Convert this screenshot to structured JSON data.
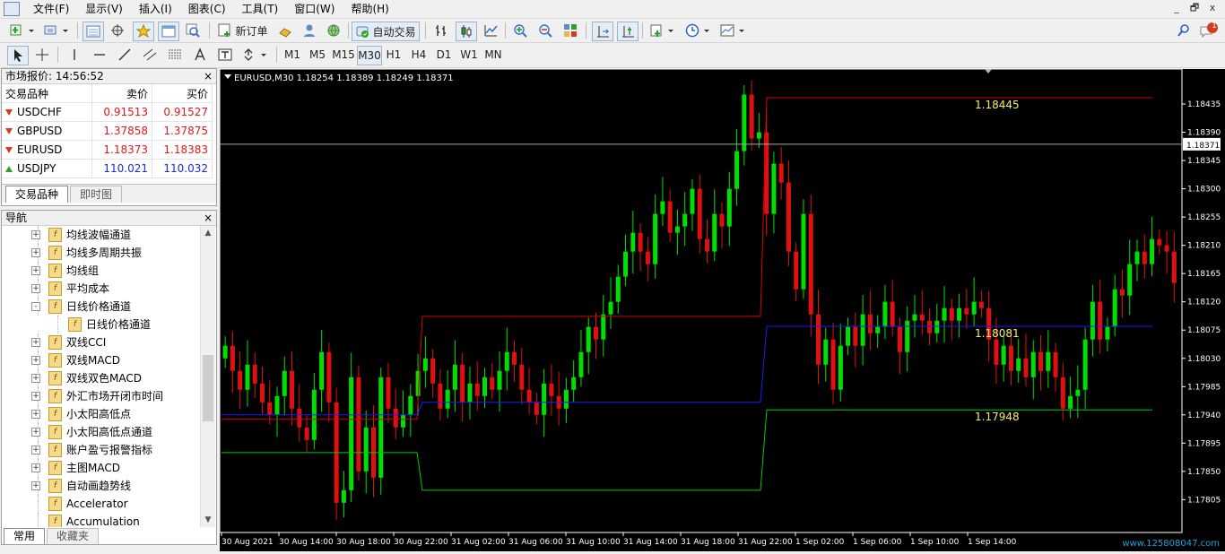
{
  "menu": [
    "文件(F)",
    "显示(V)",
    "插入(I)",
    "图表(C)",
    "工具(T)",
    "窗口(W)",
    "帮助(H)"
  ],
  "window_controls": [
    "_",
    "🗗",
    "x"
  ],
  "toolbar1": {
    "new_order": "新订单",
    "auto_trade": "自动交易",
    "notification_count": "1"
  },
  "timeframes": [
    "M1",
    "M5",
    "M15",
    "M30",
    "H1",
    "H4",
    "D1",
    "W1",
    "MN"
  ],
  "active_timeframe": "M30",
  "market_watch": {
    "title": "市场报价: 14:56:52",
    "headers": [
      "交易品种",
      "卖价",
      "买价"
    ],
    "rows": [
      {
        "symbol": "USDCHF",
        "bid": "0.91513",
        "ask": "0.91527",
        "dir": "down",
        "color": "red"
      },
      {
        "symbol": "GBPUSD",
        "bid": "1.37858",
        "ask": "1.37875",
        "dir": "down",
        "color": "red"
      },
      {
        "symbol": "EURUSD",
        "bid": "1.18373",
        "ask": "1.18383",
        "dir": "down",
        "color": "red"
      },
      {
        "symbol": "USDJPY",
        "bid": "110.021",
        "ask": "110.032",
        "dir": "up",
        "color": "blue"
      }
    ],
    "tabs": [
      "交易品种",
      "即时图"
    ]
  },
  "navigator": {
    "title": "导航",
    "items": [
      {
        "label": "均线波幅通道",
        "level": 0,
        "exp": "+"
      },
      {
        "label": "均线多周期共振",
        "level": 0,
        "exp": "+"
      },
      {
        "label": "均线组",
        "level": 0,
        "exp": "+"
      },
      {
        "label": "平均成本",
        "level": 0,
        "exp": "+"
      },
      {
        "label": "日线价格通道",
        "level": 0,
        "exp": "-"
      },
      {
        "label": "日线价格通道",
        "level": 1,
        "exp": ""
      },
      {
        "label": "双线CCI",
        "level": 0,
        "exp": "+"
      },
      {
        "label": "双线MACD",
        "level": 0,
        "exp": "+"
      },
      {
        "label": "双线双色MACD",
        "level": 0,
        "exp": "+"
      },
      {
        "label": "外汇市场开闭市时间",
        "level": 0,
        "exp": "+"
      },
      {
        "label": "小太阳高低点",
        "level": 0,
        "exp": "+"
      },
      {
        "label": "小太阳高低点通道",
        "level": 0,
        "exp": "+"
      },
      {
        "label": "账户盈亏报警指标",
        "level": 0,
        "exp": "+"
      },
      {
        "label": "主图MACD",
        "level": 0,
        "exp": "+"
      },
      {
        "label": "自动画趋势线",
        "level": 0,
        "exp": "+"
      },
      {
        "label": "Accelerator",
        "level": 0,
        "exp": ""
      },
      {
        "label": "Accumulation",
        "level": 0,
        "exp": ""
      }
    ],
    "footer_tabs": [
      "常用",
      "收藏夹"
    ]
  },
  "chart": {
    "header": "EURUSD,M30  1.18254 1.18389 1.18249 1.18371",
    "current_price_label": "1.18371",
    "level_labels": {
      "upper": "1.18445",
      "middle": "1.18081",
      "lower": "1.17948"
    },
    "watermark": "www.125808047.com"
  },
  "chart_data": {
    "type": "candlestick",
    "symbol": "EURUSD",
    "timeframe": "M30",
    "ylim": [
      1.17757,
      1.18485
    ],
    "y_ticks": [
      "1.18435",
      "1.18390",
      "1.18345",
      "1.18300",
      "1.18255",
      "1.18210",
      "1.18165",
      "1.18120",
      "1.18075",
      "1.18030",
      "1.17985",
      "1.17940",
      "1.17895",
      "1.17850",
      "1.17805"
    ],
    "x_ticks": [
      "30 Aug 2021",
      "30 Aug 14:00",
      "30 Aug 18:00",
      "30 Aug 22:00",
      "31 Aug 02:00",
      "31 Aug 06:00",
      "31 Aug 10:00",
      "31 Aug 14:00",
      "31 Aug 18:00",
      "31 Aug 22:00",
      "1 Sep 02:00",
      "1 Sep 06:00",
      "1 Sep 10:00",
      "1 Sep 14:00"
    ],
    "current_price": 1.18371,
    "colors": {
      "bull": "#00e000",
      "bear": "#e01010",
      "upper": "#e00000",
      "middle": "#1a1aff",
      "lower": "#00cc00",
      "level_text": "#f0f070"
    },
    "ohlc_close": [
      1.1805,
      1.1801,
      1.1798,
      1.1802,
      1.1799,
      1.1796,
      1.1794,
      1.1797,
      1.1801,
      1.1795,
      1.1792,
      1.179,
      1.1798,
      1.1804,
      1.1796,
      1.178,
      1.1782,
      1.18,
      1.1785,
      1.1792,
      1.1784,
      1.18,
      1.1795,
      1.1792,
      1.1794,
      1.1797,
      1.1801,
      1.1803,
      1.1799,
      1.1795,
      1.1798,
      1.1802,
      1.1796,
      1.1799,
      1.1797,
      1.18,
      1.1798,
      1.1801,
      1.1804,
      1.1802,
      1.1798,
      1.1796,
      1.1794,
      1.1799,
      1.1797,
      1.1795,
      1.1798,
      1.18,
      1.1804,
      1.1808,
      1.1806,
      1.181,
      1.1812,
      1.1816,
      1.182,
      1.1823,
      1.182,
      1.1818,
      1.1826,
      1.1828,
      1.1823,
      1.1824,
      1.1826,
      1.183,
      1.1822,
      1.182,
      1.1826,
      1.1824,
      1.183,
      1.1836,
      1.1845,
      1.1838,
      1.1839,
      1.1826,
      1.1834,
      1.1831,
      1.182,
      1.1814,
      1.1826,
      1.181,
      1.1802,
      1.1806,
      1.1798,
      1.1805,
      1.1808,
      1.1805,
      1.181,
      1.1807,
      1.1808,
      1.1812,
      1.1808,
      1.1804,
      1.1809,
      1.181,
      1.1809,
      1.1807,
      1.1809,
      1.1811,
      1.1809,
      1.1811,
      1.181,
      1.1812,
      1.1811,
      1.1806,
      1.1802,
      1.1805,
      1.1801,
      1.1803,
      1.18,
      1.1804,
      1.1801,
      1.1804,
      1.18,
      1.1795,
      1.1797,
      1.1798,
      1.1806,
      1.1812,
      1.1806,
      1.1808,
      1.1814,
      1.1813,
      1.1818,
      1.182,
      1.1818,
      1.1822,
      1.1821,
      1.182,
      1.1815,
      1.1828,
      1.1837
    ]
  }
}
